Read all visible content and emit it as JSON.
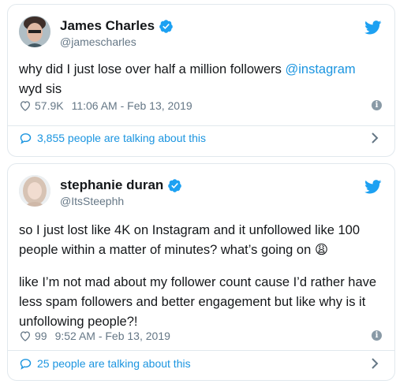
{
  "tweets": [
    {
      "name": "James Charles",
      "handle": "@jamescharles",
      "text_parts": [
        "why did I just lose over half a million followers ",
        "@instagram",
        " wyd sis"
      ],
      "likes": "57.9K",
      "timestamp": "11:06 AM - Feb 13, 2019",
      "talking": "3,855 people are talking about this",
      "icons": [
        "avatar",
        "verified-icon",
        "twitter-bird-icon",
        "heart-icon",
        "info-icon",
        "speech-bubble-icon",
        "chevron-right-icon"
      ]
    },
    {
      "name": "stephanie duran",
      "handle": "@ItsSteephh",
      "text_p1": "so I just lost like 4K on Instagram and it unfollowed like 100 people within a matter of minutes? what’s going on",
      "emoji": "😩",
      "text_p2": "like I’m not mad about my follower count cause I’d rather have less spam followers and better engagement but like why is it unfollowing people?!",
      "likes": "99",
      "timestamp": "9:52 AM - Feb 13, 2019",
      "talking": "25 people are talking about this",
      "icons": [
        "avatar",
        "verified-icon",
        "twitter-bird-icon",
        "heart-icon",
        "info-icon",
        "speech-bubble-icon",
        "chevron-right-icon"
      ]
    }
  ],
  "colors": {
    "link": "#1b95e0",
    "secondary_text": "#657786",
    "border": "#e1e8ed",
    "verified": "#1da1f2"
  }
}
